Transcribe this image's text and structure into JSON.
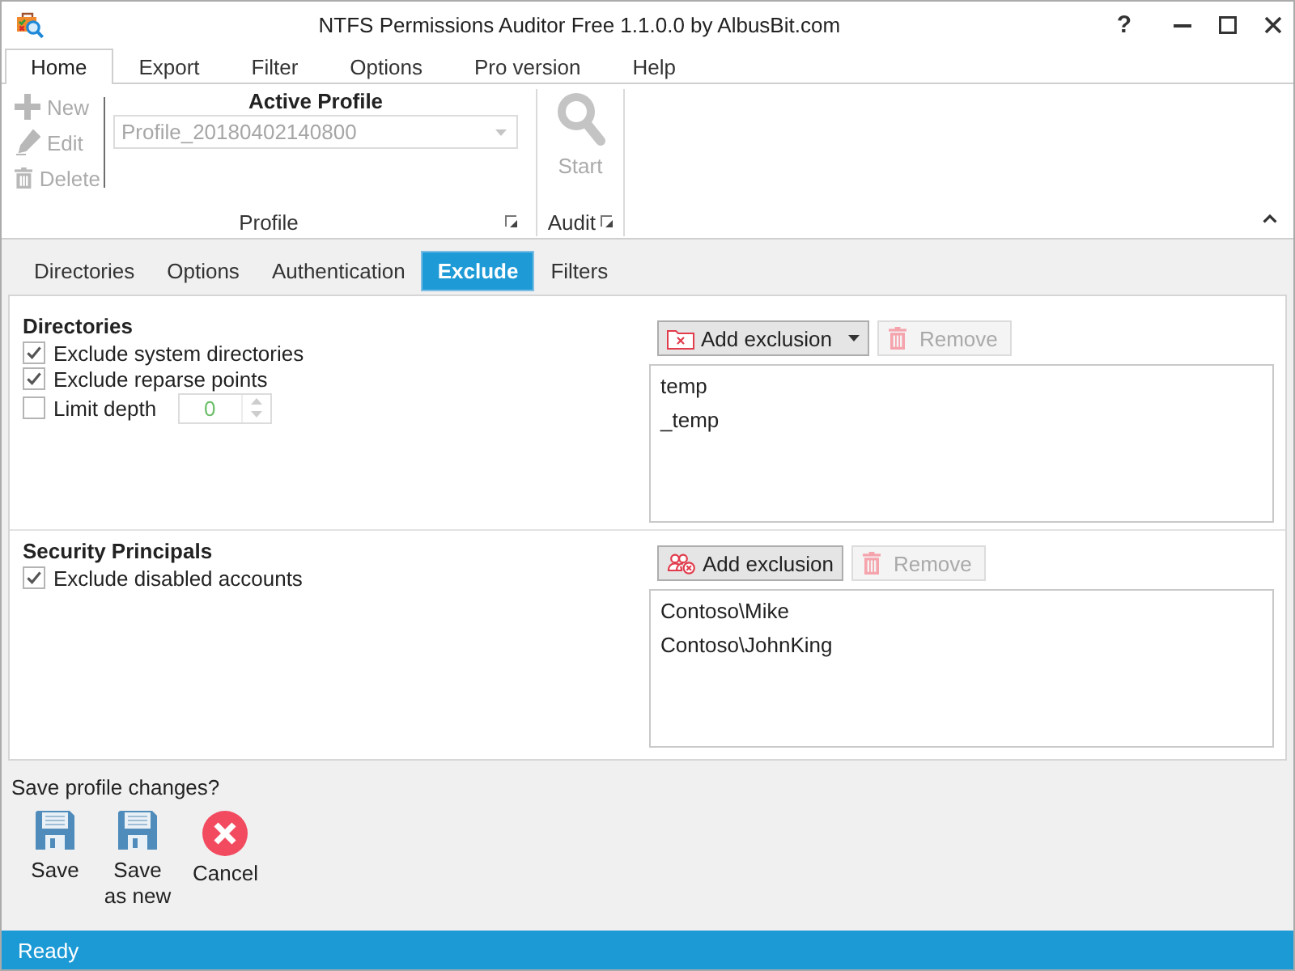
{
  "window": {
    "title": "NTFS Permissions Auditor Free 1.1.0.0 by AlbusBit.com",
    "help": "?"
  },
  "ribbon": {
    "tabs": [
      {
        "label": "Home",
        "selected": true
      },
      {
        "label": "Export",
        "selected": false
      },
      {
        "label": "Filter",
        "selected": false
      },
      {
        "label": "Options",
        "selected": false
      },
      {
        "label": "Pro version",
        "selected": false
      },
      {
        "label": "Help",
        "selected": false
      }
    ],
    "profile_group": {
      "label": "Profile",
      "buttons": [
        {
          "kind": "new",
          "label": "New",
          "disabled": true
        },
        {
          "kind": "edit",
          "label": "Edit",
          "disabled": true
        },
        {
          "kind": "delete",
          "label": "Delete",
          "disabled": true
        }
      ],
      "active_profile": {
        "label": "Active Profile",
        "value": "Profile_20180402140800",
        "disabled": true
      }
    },
    "audit_group": {
      "label": "Audit",
      "button": {
        "label": "Start",
        "disabled": true
      }
    }
  },
  "page_tabs": [
    {
      "label": "Directories",
      "selected": false
    },
    {
      "label": "Options",
      "selected": false
    },
    {
      "label": "Authentication",
      "selected": false
    },
    {
      "label": "Exclude",
      "selected": true
    },
    {
      "label": "Filters",
      "selected": false
    }
  ],
  "sections": [
    {
      "kind": "directories",
      "heading": "Directories",
      "options": [
        {
          "label": "Exclude system directories",
          "checked": true
        },
        {
          "label": "Exclude reparse points",
          "checked": true
        },
        {
          "label": "Limit depth",
          "checked": false,
          "spinner": {
            "value": "0",
            "disabled": true
          }
        }
      ],
      "add_button": {
        "label": "Add exclusion",
        "dropdown": true
      },
      "remove_button": {
        "label": "Remove",
        "disabled": true
      },
      "items": [
        "temp",
        "_temp"
      ]
    },
    {
      "kind": "principals",
      "heading": "Security Principals",
      "options": [
        {
          "label": "Exclude disabled accounts",
          "checked": true
        }
      ],
      "add_button": {
        "label": "Add exclusion"
      },
      "remove_button": {
        "label": "Remove",
        "disabled": true
      },
      "items": [
        "Contoso\\Mike",
        "Contoso\\JohnKing"
      ]
    }
  ],
  "save_prompt": {
    "question": "Save profile changes?",
    "buttons": [
      {
        "kind": "save",
        "label": "Save"
      },
      {
        "kind": "save_new",
        "label": "Save as new"
      },
      {
        "kind": "cancel",
        "label": "Cancel"
      }
    ]
  },
  "status_bar": {
    "text": "Ready"
  }
}
